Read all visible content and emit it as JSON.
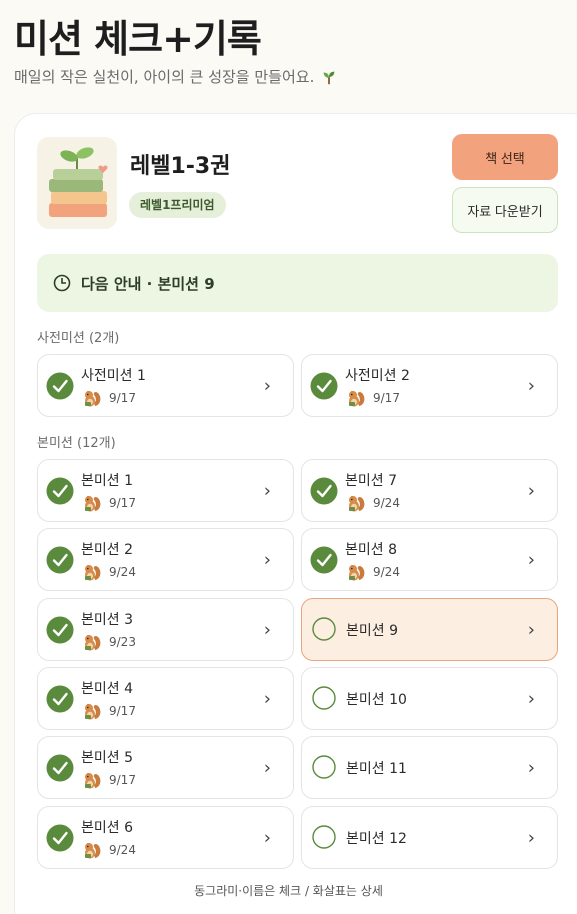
{
  "header": {
    "title": "미션 체크+기록",
    "subtitle": "매일의 작은 실천이, 아이의 큰 성장을 만들어요."
  },
  "book": {
    "title": "레벨1-3권",
    "level_badge": "레벨1프리미엄",
    "select_button": "책 선택",
    "download_button": "자료 다운받기"
  },
  "next_banner": {
    "text": "다음 안내 · 본미션 9"
  },
  "sections": {
    "pre_label": "사전미션 (2개)",
    "main_label": "본미션 (12개)"
  },
  "pre_missions": [
    {
      "name": "사전미션 1",
      "date": "9/17",
      "done": true
    },
    {
      "name": "사전미션 2",
      "date": "9/17",
      "done": true
    }
  ],
  "main_missions": [
    {
      "name": "본미션 1",
      "date": "9/17",
      "done": true
    },
    {
      "name": "본미션 7",
      "date": "9/24",
      "done": true
    },
    {
      "name": "본미션 2",
      "date": "9/24",
      "done": true
    },
    {
      "name": "본미션 8",
      "date": "9/24",
      "done": true
    },
    {
      "name": "본미션 3",
      "date": "9/23",
      "done": true
    },
    {
      "name": "본미션 9",
      "date": "",
      "done": false,
      "current": true
    },
    {
      "name": "본미션 4",
      "date": "9/17",
      "done": true
    },
    {
      "name": "본미션 10",
      "date": "",
      "done": false
    },
    {
      "name": "본미션 5",
      "date": "9/17",
      "done": true
    },
    {
      "name": "본미션 11",
      "date": "",
      "done": false
    },
    {
      "name": "본미션 6",
      "date": "9/24",
      "done": true
    },
    {
      "name": "본미션 12",
      "date": "",
      "done": false
    }
  ],
  "chevron": "›",
  "footer": {
    "hint": "동그라미·이름은 체크 / 화살표는 상세"
  },
  "colors": {
    "check_green": "#5a8a3c",
    "accent_orange": "#f2a27d",
    "banner_green": "#edf6e3",
    "current_bg": "#fdeee2"
  },
  "icons": {
    "check": "check-circle-icon",
    "pending": "empty-circle-icon",
    "clock": "clock-icon",
    "sprout": "sprout-icon",
    "squirrel": "squirrel-icon",
    "chevron": "chevron-right-icon"
  }
}
